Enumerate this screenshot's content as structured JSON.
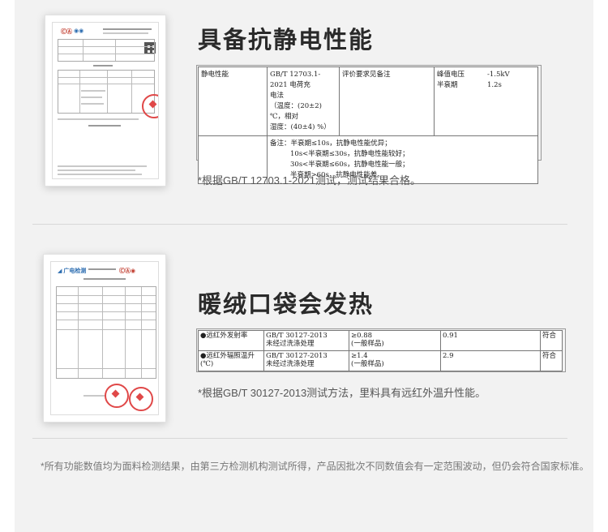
{
  "section1": {
    "heading": "具备抗静电性能",
    "table": {
      "property": "静电性能",
      "method_line1": "GB/T 12703.1-2021 电荷充",
      "method_line2": "电法",
      "method_line3": "（温度：(20±2) ℃，相对",
      "method_line4": "湿度：(40±4) %）",
      "requirement": "评价要求见备注",
      "metric1_label": "峰值电压",
      "metric1_value": "-1.5kV",
      "metric2_label": "半衰期",
      "metric2_value": "1.2s",
      "remark_line1": "备注：半衰期≤10s，抗静电性能优异；",
      "remark_line2": "10s<半衰期≤30s，抗静电性能较好；",
      "remark_line3": "30s<半衰期≤60s，抗静电性能一般；",
      "remark_line4": "半衰期>60s，抗静电性能差。"
    },
    "note": "*根据GB/T 12703.1-2021测试，测试结果合格。"
  },
  "section2": {
    "heading": "暖绒口袋会发热",
    "table": {
      "rows": [
        {
          "item": "●远红外发射率",
          "method_line1": "GB/T 30127-2013",
          "method_line2": "未经过洗涤处理",
          "req_line1": "≥0.88",
          "req_line2": "(一般样品)",
          "result": "0.91",
          "verdict": "符合"
        },
        {
          "item": "●远红外辐照温升",
          "item_unit": "(℃)",
          "method_line1": "GB/T 30127-2013",
          "method_line2": "未经过洗涤处理",
          "req_line1": "≥1.4",
          "req_line2": "(一般样品)",
          "result": "2.9",
          "verdict": "符合"
        }
      ]
    },
    "note": "*根据GB/T 30127-2013测试方法，里料具有远红外温升性能。"
  },
  "footer": "*所有功能数值均为面料检测结果，由第三方检测机构测试所得，产品因批次不同数值会有一定范围波动，但仍会符合国家标准。"
}
